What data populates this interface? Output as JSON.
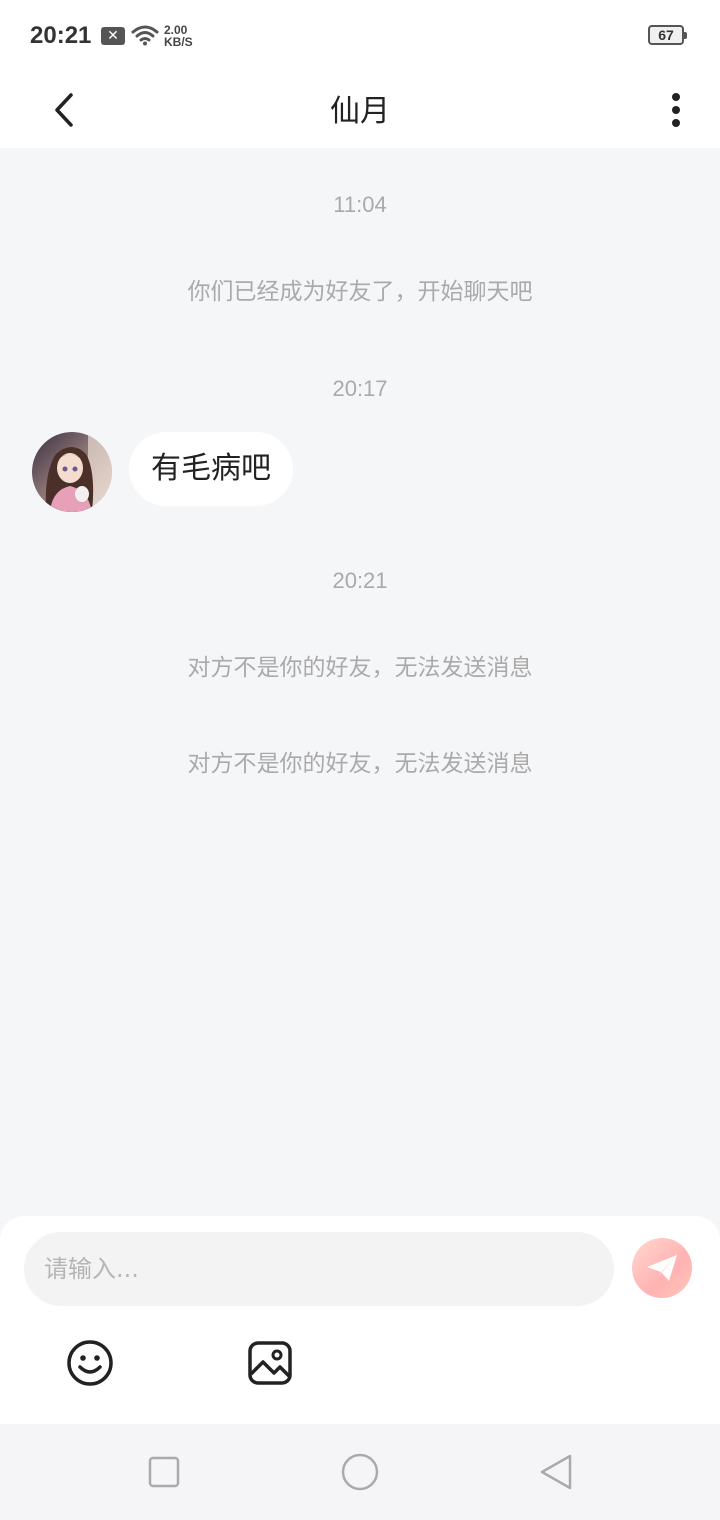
{
  "status_bar": {
    "time": "20:21",
    "notification_icon": "x-box-icon",
    "wifi_icon": "wifi-icon",
    "net_speed_value": "2.00",
    "net_speed_unit": "KB/S",
    "battery_level": "67"
  },
  "header": {
    "back_icon": "chevron-left-icon",
    "title": "仙月",
    "more_icon": "more-vertical-icon"
  },
  "chat": {
    "items": [
      {
        "type": "timestamp",
        "text": "11:04"
      },
      {
        "type": "system",
        "text": "你们已经成为好友了，开始聊天吧"
      },
      {
        "type": "timestamp",
        "text": "20:17"
      },
      {
        "type": "message",
        "sender": "other",
        "avatar_icon": "avatar-image",
        "text": "有毛病吧"
      },
      {
        "type": "timestamp",
        "text": "20:21"
      },
      {
        "type": "system",
        "text": "对方不是你的好友，无法发送消息"
      },
      {
        "type": "system",
        "text": "对方不是你的好友，无法发送消息"
      }
    ]
  },
  "composer": {
    "placeholder": "请输入...",
    "value": "",
    "send_icon": "paper-plane-icon",
    "tools": [
      {
        "icon": "emoji-icon"
      },
      {
        "icon": "image-icon"
      }
    ]
  },
  "nav_bar": {
    "buttons": [
      {
        "icon": "recents-square-icon"
      },
      {
        "icon": "home-circle-icon"
      },
      {
        "icon": "back-triangle-icon"
      }
    ]
  },
  "colors": {
    "background": "#f5f6f8",
    "muted_text": "#aaaaaa",
    "send_accent": "#ffb2b2"
  }
}
